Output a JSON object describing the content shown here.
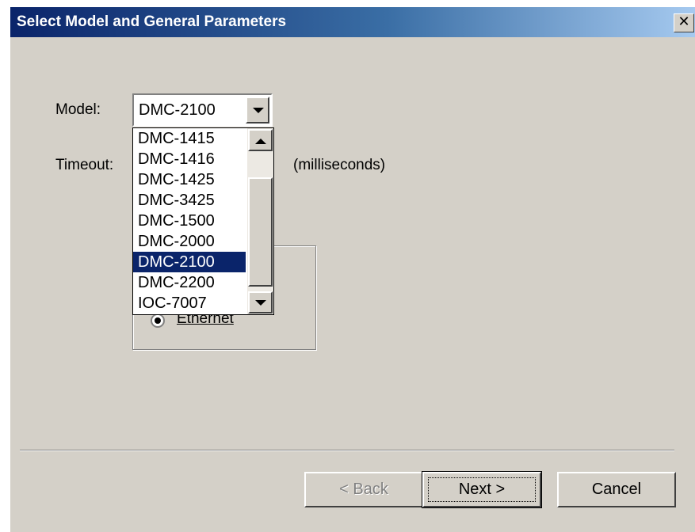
{
  "window": {
    "title": "Select Model and General Parameters",
    "close_glyph": "✕"
  },
  "form": {
    "model_label": "Model:",
    "model_value": "DMC-2100",
    "timeout_label": "Timeout:",
    "timeout_unit": "(milliseconds)"
  },
  "dropdown": {
    "options": [
      "DMC-1415",
      "DMC-1416",
      "DMC-1425",
      "DMC-3425",
      "DMC-1500",
      "DMC-2000",
      "DMC-2100",
      "DMC-2200",
      "IOC-7007"
    ],
    "selected_index": 6
  },
  "connection": {
    "selected_option": "Ethernet"
  },
  "buttons": {
    "back": "< Back",
    "next": "Next >",
    "cancel": "Cancel"
  },
  "colors": {
    "selection": "#0a246a",
    "face": "#d4d0c8"
  }
}
